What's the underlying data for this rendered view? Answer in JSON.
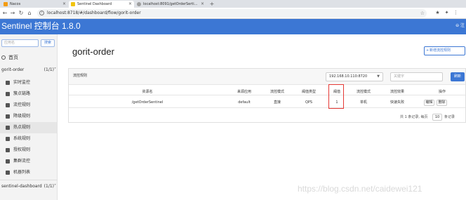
{
  "browser": {
    "tabs": [
      {
        "label": "Nacos",
        "color": "#f39c12"
      },
      {
        "label": "Sentinel Dashboard",
        "color": "#f1c40f"
      },
      {
        "label": "localhost:8091/getOrderSerti…",
        "color": "#9e9e9e"
      }
    ],
    "url": "localhost:8718/#/dashboard/flow/gorit-order"
  },
  "header": {
    "title": "Sentinel 控制台 1.8.0",
    "logout": "⊖ 注"
  },
  "sidebar": {
    "search_placeholder": "应用名",
    "search_button": "搜索",
    "home": "首页",
    "app_name": "gorit-order",
    "app_count": "(1/1)",
    "items": [
      {
        "label": "实时监控"
      },
      {
        "label": "簇点链路"
      },
      {
        "label": "流控规则"
      },
      {
        "label": "降级规则"
      },
      {
        "label": "热点规则"
      },
      {
        "label": "系统规则"
      },
      {
        "label": "授权规则"
      },
      {
        "label": "集群流控"
      },
      {
        "label": "机器列表"
      }
    ],
    "app2_name": "sentinel-dashboard",
    "app2_count": "(1/1)"
  },
  "main": {
    "title": "gorit-order",
    "add_button": "新增流控规则",
    "card_title": "流控规则",
    "machine": "192.168.10.110:8720",
    "keyword_placeholder": "关键字",
    "refresh": "刷新",
    "columns": [
      "资源名",
      "来源应用",
      "流控模式",
      "阈值类型",
      "阈值",
      "流控模式",
      "流控效果",
      "操作"
    ],
    "row": {
      "resource": "/getOrderSentinel",
      "source": "default",
      "mode": "直接",
      "threshold_type": "QPS",
      "threshold": "1",
      "cluster_mode": "单机",
      "effect": "快速失败",
      "edit": "编辑",
      "delete": "删除"
    },
    "pager_left": "共 1 条记录, 每页",
    "page_size": "10",
    "pager_right": "条记录"
  },
  "watermark": "https://blog.csdn.net/caidewei121"
}
